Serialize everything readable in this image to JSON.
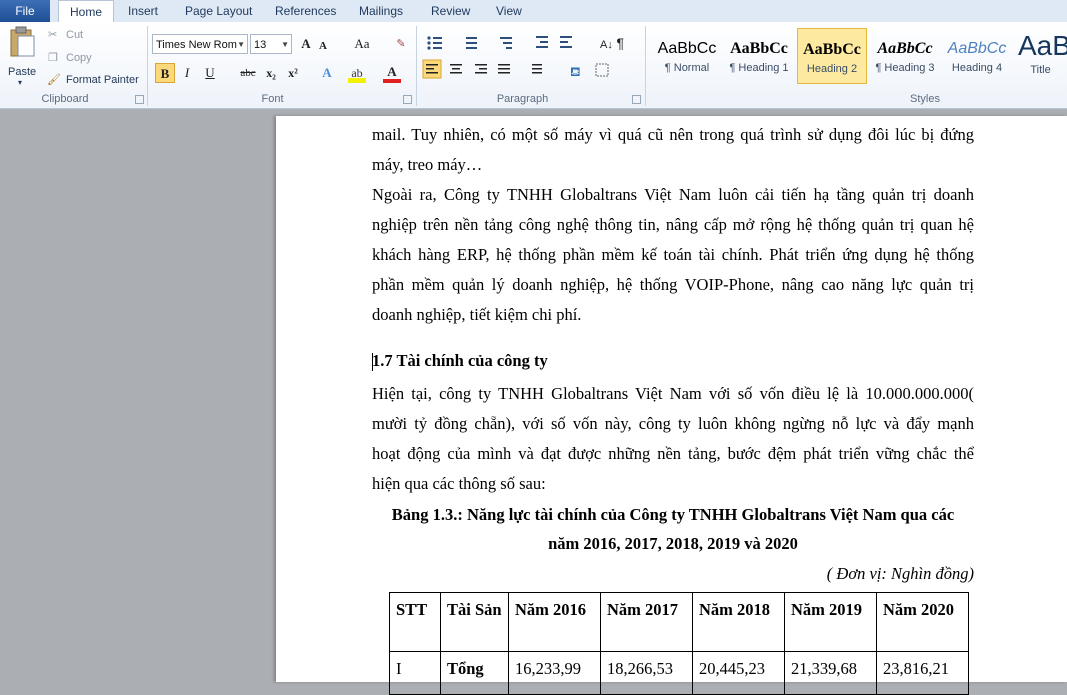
{
  "tabs": [
    "File",
    "Home",
    "Insert",
    "Page Layout",
    "References",
    "Mailings",
    "Review",
    "View"
  ],
  "clipboard": {
    "paste": "Paste",
    "cut": "Cut",
    "copy": "Copy",
    "format_painter": "Format Painter",
    "label": "Clipboard"
  },
  "font": {
    "name": "Times New Rom",
    "size": "13",
    "label": "Font",
    "aa": "Aa",
    "grow": "A",
    "shrink": "A",
    "bold": "B",
    "italic": "I",
    "underline": "U",
    "strike": "abc",
    "sub": "x₂",
    "sup": "x²",
    "color_a": "A"
  },
  "paragraph": {
    "label": "Paragraph"
  },
  "styles": {
    "label": "Styles",
    "items": [
      {
        "preview": "AaBbCс",
        "name": "¶ Normal"
      },
      {
        "preview": "AaBbCc",
        "name": "¶ Heading 1"
      },
      {
        "preview": "AaBbCc",
        "name": "Heading 2"
      },
      {
        "preview": "AaBbCc",
        "name": "¶ Heading 3"
      },
      {
        "preview": "AaBbCc",
        "name": "Heading 4"
      },
      {
        "preview": "AaB",
        "name": "Title"
      }
    ],
    "selected_index": 2
  },
  "document": {
    "lines": [
      "mail. Tuy nhiên, có một số máy vì quá cũ nên trong quá trình sử dụng đôi lúc bị đứng",
      "máy, treo máy…",
      "Ngoài ra, Công ty TNHH Globaltrans Việt Nam luôn  cải tiến hạ tầng quản trị doanh",
      "nghiệp trên nền tảng công nghệ thông tin, nâng cấp mở rộng hệ thống quản trị quan hệ",
      "khách hàng ERP, hệ thống phần mềm kế toán tài chính. Phát triển ứng dụng hệ thống",
      "phần mềm quản lý doanh nghiệp, hệ thống VOIP-Phone, nâng cao năng lực quản trị",
      "doanh nghiệp, tiết kiệm chi phí."
    ],
    "heading": "1.7 Tài chính của công ty",
    "para2": [
      "Hiện tại, công ty TNHH Globaltrans Việt Nam với số vốn điều lệ là 10.000.000.000(",
      "mười tỷ đồng chẵn), với số vốn này, công ty luôn không ngừng nỗ lực và đẩy mạnh",
      "hoạt động của mình và đạt được những nền tảng, bước đệm phát triển vững chắc thể",
      "hiện qua các thông số sau:"
    ],
    "caption_line1": "Bảng 1.3.: Năng lực tài chính của Công ty TNHH Globaltrans Việt Nam qua các",
    "caption_line2": "năm 2016, 2017, 2018, 2019 và 2020",
    "unit": "( Đơn vị: Nghìn đồng)",
    "table": {
      "headers": [
        "STT",
        "Tài Sản",
        "Năm 2016",
        "Năm 2017",
        "Năm 2018",
        "Năm 2019",
        "Năm 2020"
      ],
      "rows": [
        [
          "I",
          "Tổng",
          "16,233,99",
          "18,266,53",
          "20,445,23",
          "21,339,68",
          "23,816,21"
        ]
      ]
    }
  }
}
